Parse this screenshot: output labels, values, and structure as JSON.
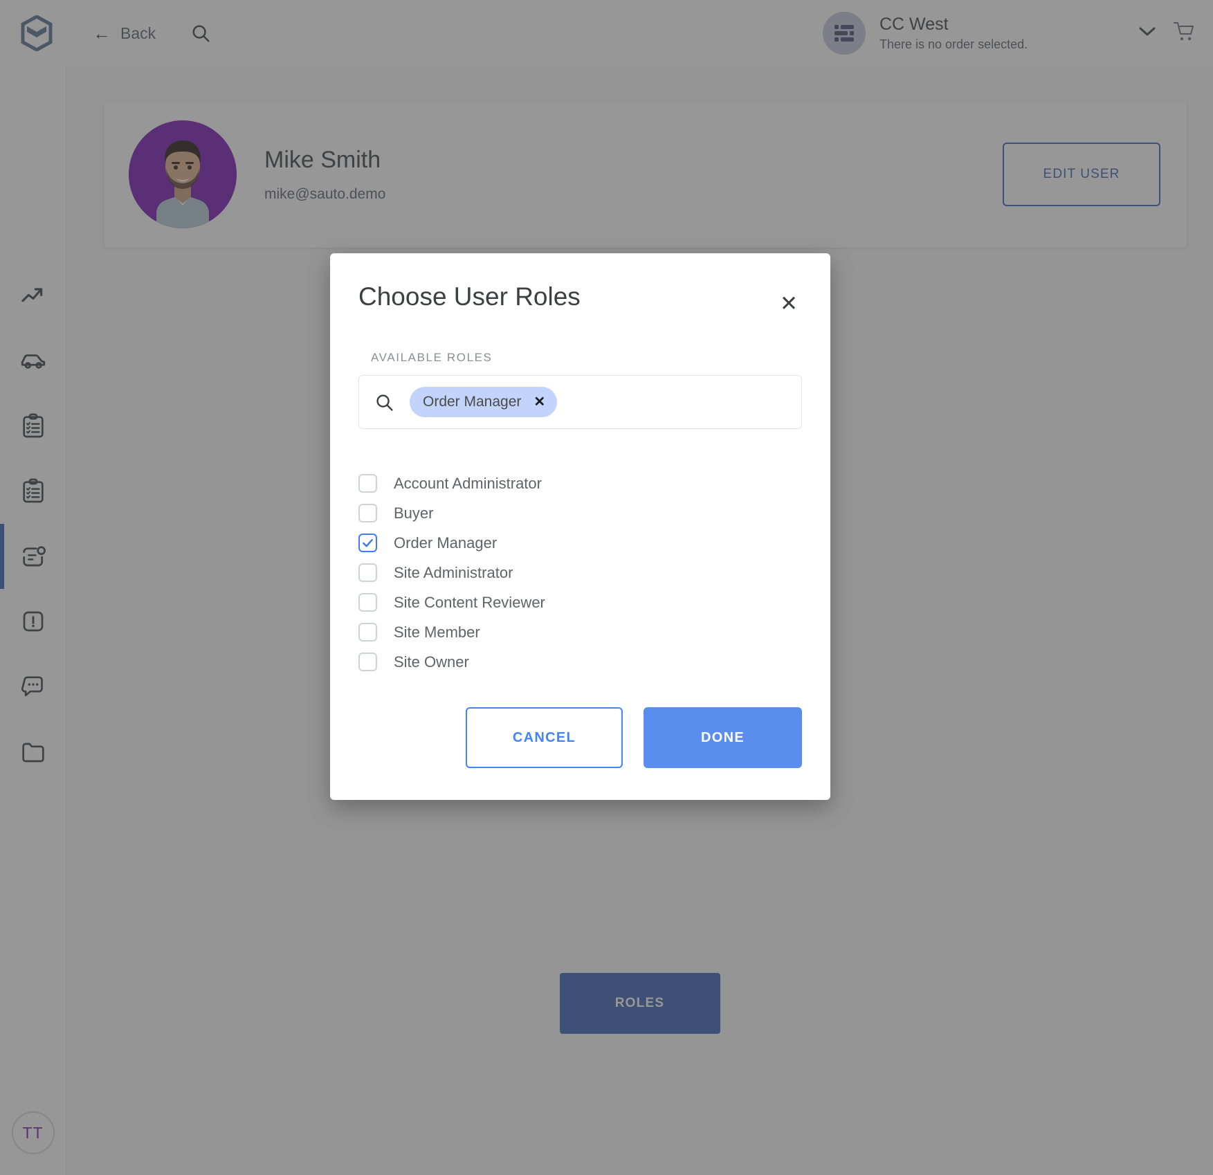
{
  "header": {
    "logo_icon": "cube-logo-icon",
    "back_label": "Back",
    "back_icon": "arrow-left-icon",
    "search_icon": "search-icon",
    "order_icon": "order-list-icon",
    "order_title": "CC West",
    "order_subtitle": "There is no order selected.",
    "chevron_icon": "chevron-down-icon",
    "cart_icon": "shopping-cart-icon"
  },
  "sidebar": {
    "items": [
      {
        "icon": "trending-up-icon",
        "name": "analytics",
        "active": false
      },
      {
        "icon": "car-icon",
        "name": "vehicles",
        "active": false
      },
      {
        "icon": "clipboard-list-icon",
        "name": "orders",
        "active": false
      },
      {
        "icon": "clipboard-list-alt-icon",
        "name": "quotes",
        "active": false
      },
      {
        "icon": "contact-card-icon",
        "name": "users",
        "active": true
      },
      {
        "icon": "alert-square-icon",
        "name": "alerts",
        "active": false
      },
      {
        "icon": "chat-bubble-icon",
        "name": "messages",
        "active": false
      },
      {
        "icon": "folder-icon",
        "name": "files",
        "active": false
      }
    ],
    "avatar_initials": "TT"
  },
  "profile": {
    "name": "Mike Smith",
    "email": "mike@sauto.demo",
    "avatar_name": "user-avatar-photo",
    "edit_button": "EDIT USER"
  },
  "page": {
    "roles_button": "ROLES"
  },
  "modal": {
    "title": "Choose User Roles",
    "close_icon": "close-icon",
    "field_label": "AVAILABLE ROLES",
    "search_icon": "search-icon",
    "search_placeholder": "",
    "search_value": "",
    "chips": [
      {
        "label": "Order Manager",
        "remove_icon": "chip-remove-icon"
      }
    ],
    "roles": [
      {
        "label": "Account Administrator",
        "checked": false
      },
      {
        "label": "Buyer",
        "checked": false
      },
      {
        "label": "Order Manager",
        "checked": true
      },
      {
        "label": "Site Administrator",
        "checked": false
      },
      {
        "label": "Site Content Reviewer",
        "checked": false
      },
      {
        "label": "Site Member",
        "checked": false
      },
      {
        "label": "Site Owner",
        "checked": false
      }
    ],
    "cancel_label": "CANCEL",
    "done_label": "DONE"
  },
  "colors": {
    "accent_blue": "#4285f4",
    "done_blue": "#5b8def",
    "brand_blue": "#3a62b5",
    "chip_blue": "#c3d4fc",
    "avatar_purple": "#7b19b5",
    "overlay": "rgba(66,66,66,.55)"
  }
}
